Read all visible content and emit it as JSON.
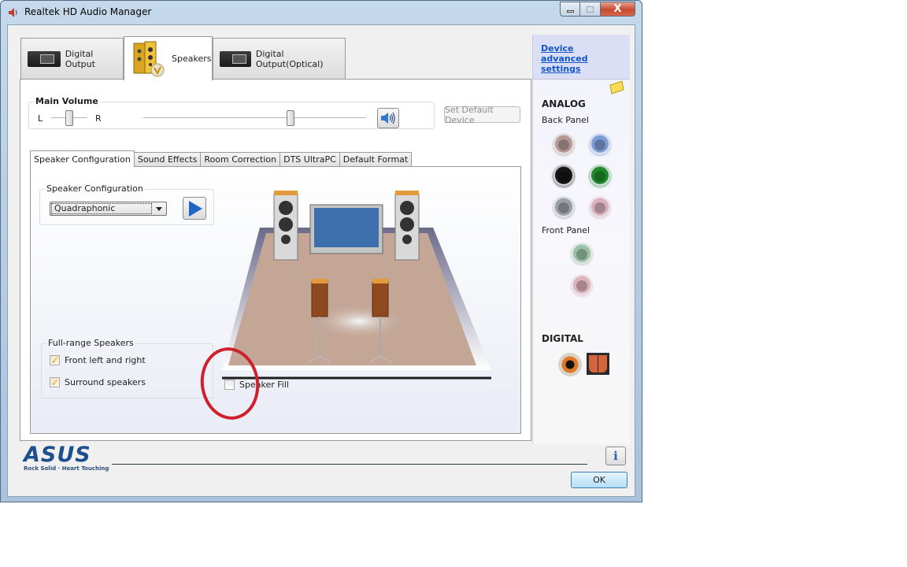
{
  "window": {
    "title": "Realtek HD Audio Manager",
    "controls": {
      "minimize": "–",
      "maximize": "□",
      "close": "X"
    }
  },
  "device_tabs": [
    {
      "label": "Digital Output",
      "icon": "receiver-icon",
      "active": false
    },
    {
      "label": "Speakers",
      "icon": "speakers-icon",
      "active": true
    },
    {
      "label": "Digital Output(Optical)",
      "icon": "receiver-icon",
      "active": false
    }
  ],
  "main_volume": {
    "label": "Main Volume",
    "balance_left": "L",
    "balance_right": "R",
    "balance_value_percent": 50,
    "volume_value_percent": 66,
    "mute_icon": "speaker-volume-icon",
    "set_default_label": "Set Default Device"
  },
  "sub_tabs": [
    {
      "label": "Speaker Configuration",
      "active": true
    },
    {
      "label": "Sound Effects",
      "active": false
    },
    {
      "label": "Room Correction",
      "active": false
    },
    {
      "label": "DTS UltraPC",
      "active": false
    },
    {
      "label": "Default Format",
      "active": false
    }
  ],
  "speaker_configuration": {
    "group_label": "Speaker Configuration",
    "selected": "Quadraphonic",
    "play_icon": "play-icon"
  },
  "full_range": {
    "group_label": "Full-range Speakers",
    "options": [
      {
        "label": "Front left and right",
        "checked": true
      },
      {
        "label": "Surround speakers",
        "checked": true
      }
    ]
  },
  "speaker_fill": {
    "label": "Speaker Fill",
    "checked": false
  },
  "right_panel": {
    "link": "Device advanced settings",
    "analog_title": "ANALOG",
    "back_panel_label": "Back Panel",
    "back_jacks": [
      {
        "name": "jack-brown",
        "color": "#b59a94"
      },
      {
        "name": "jack-blue",
        "color": "#7d9ed4"
      },
      {
        "name": "jack-black",
        "color": "#151515"
      },
      {
        "name": "jack-green",
        "color": "#1f8a2c"
      },
      {
        "name": "jack-gray",
        "color": "#9a9ea5"
      },
      {
        "name": "jack-pink",
        "color": "#d9b0bb"
      }
    ],
    "front_panel_label": "Front Panel",
    "front_jacks": [
      {
        "name": "jack-green-light",
        "color": "#9bc2a5"
      },
      {
        "name": "jack-pink-light",
        "color": "#dcb2bd"
      }
    ],
    "digital_title": "DIGITAL"
  },
  "footer": {
    "brand": "ASUS",
    "tagline": "Rock Solid · Heart Touching",
    "ok_label": "OK",
    "info_icon": "info-icon"
  }
}
